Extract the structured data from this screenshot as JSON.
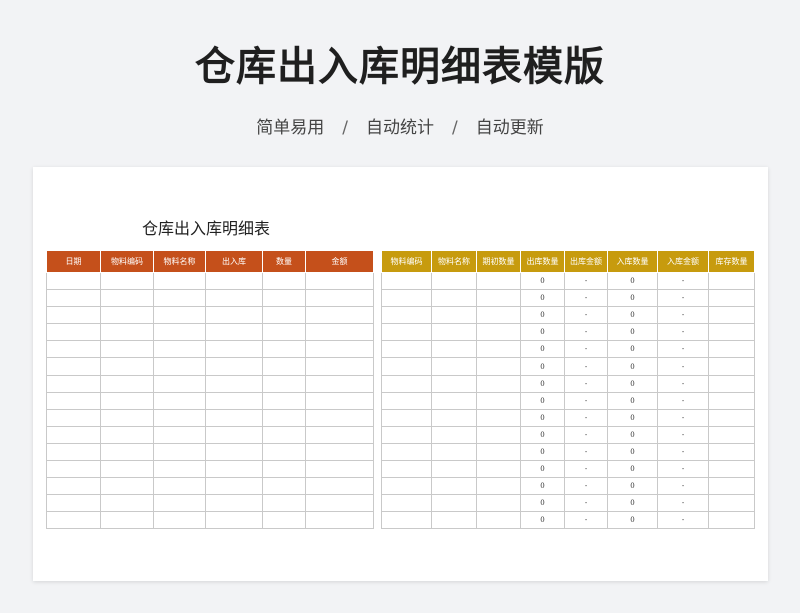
{
  "hero": {
    "title": "仓库出入库明细表模版",
    "subtitle": [
      "简单易用",
      "自动统计",
      "自动更新"
    ],
    "separator": "/"
  },
  "sheet": {
    "title": "仓库出入库明细表"
  },
  "left_table": {
    "header_color": "#c5501b",
    "columns": [
      "日期",
      "物料编码",
      "物料名称",
      "出入库",
      "数量",
      "金额"
    ],
    "row_count": 15
  },
  "right_table": {
    "header_color": "#c79b0e",
    "columns": [
      "物料编码",
      "物料名称",
      "期初数量",
      "出库数量",
      "出库金额",
      "入库数量",
      "入库金额",
      "库存数量"
    ],
    "rows": [
      [
        "",
        "",
        "",
        "0",
        "-",
        "0",
        "-",
        ""
      ],
      [
        "",
        "",
        "",
        "0",
        "-",
        "0",
        "-",
        ""
      ],
      [
        "",
        "",
        "",
        "0",
        "-",
        "0",
        "-",
        ""
      ],
      [
        "",
        "",
        "",
        "0",
        "-",
        "0",
        "-",
        ""
      ],
      [
        "",
        "",
        "",
        "0",
        "-",
        "0",
        "-",
        ""
      ],
      [
        "",
        "",
        "",
        "0",
        "-",
        "0",
        "-",
        ""
      ],
      [
        "",
        "",
        "",
        "0",
        "-",
        "0",
        "-",
        ""
      ],
      [
        "",
        "",
        "",
        "0",
        "-",
        "0",
        "-",
        ""
      ],
      [
        "",
        "",
        "",
        "0",
        "-",
        "0",
        "-",
        ""
      ],
      [
        "",
        "",
        "",
        "0",
        "-",
        "0",
        "-",
        ""
      ],
      [
        "",
        "",
        "",
        "0",
        "-",
        "0",
        "-",
        ""
      ],
      [
        "",
        "",
        "",
        "0",
        "-",
        "0",
        "-",
        ""
      ],
      [
        "",
        "",
        "",
        "0",
        "-",
        "0",
        "-",
        ""
      ],
      [
        "",
        "",
        "",
        "0",
        "-",
        "0",
        "-",
        ""
      ],
      [
        "",
        "",
        "",
        "0",
        "-",
        "0",
        "-",
        ""
      ]
    ]
  }
}
